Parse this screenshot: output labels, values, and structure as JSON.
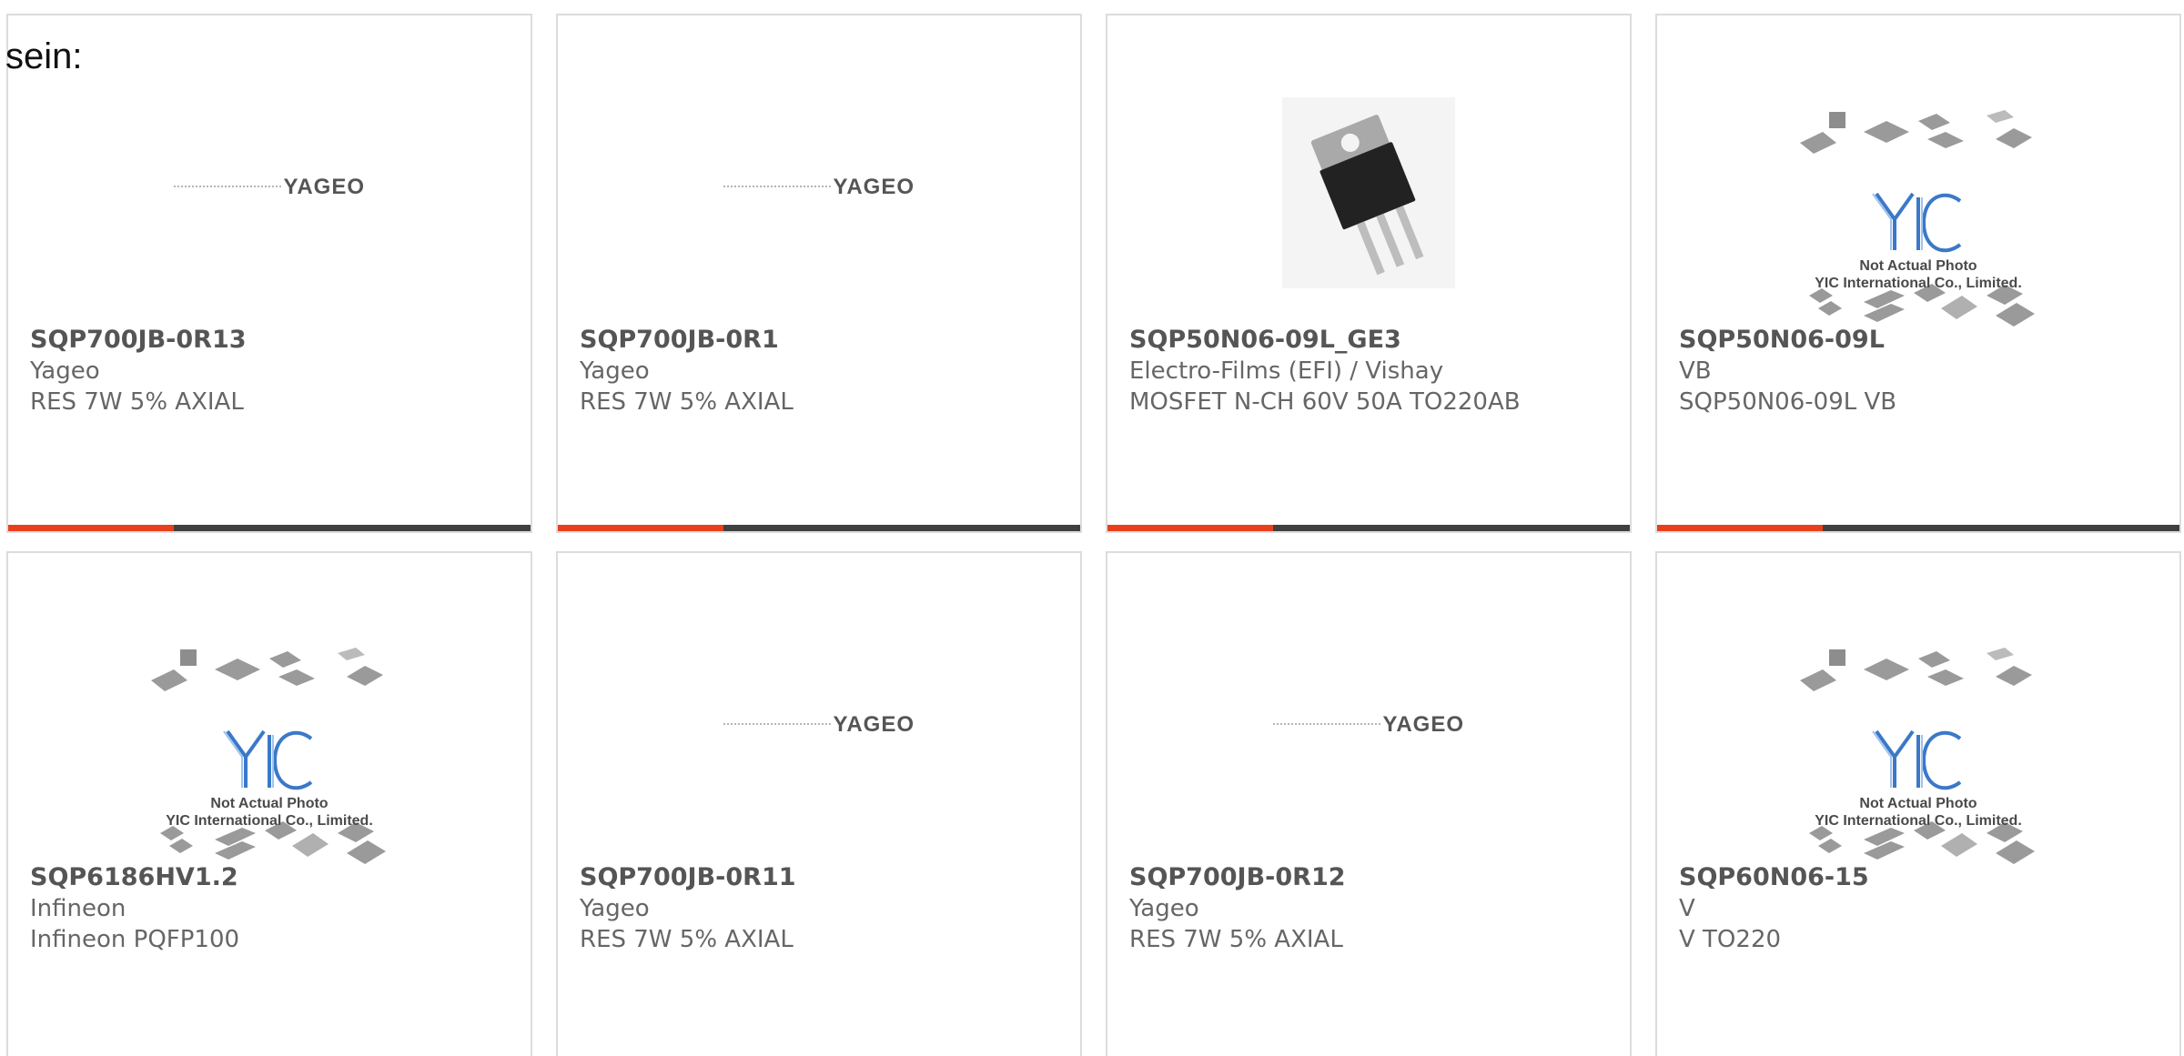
{
  "intro": "sein:",
  "cards": [
    {
      "part": "SQP700JB-0R13",
      "manufacturer": "Yageo",
      "description": "RES 7W 5% AXIAL",
      "image": "yageo-logo"
    },
    {
      "part": "SQP700JB-0R1",
      "manufacturer": "Yageo",
      "description": "RES 7W 5% AXIAL",
      "image": "yageo-logo"
    },
    {
      "part": "SQP50N06-09L_GE3",
      "manufacturer": "Electro-Films (EFI) / Vishay",
      "description": "MOSFET N-CH 60V 50A TO220AB",
      "image": "to220-transistor-photo"
    },
    {
      "part": "SQP50N06-09L",
      "manufacturer": "VB",
      "description": "SQP50N06-09L VB",
      "image": "yic-not-actual-photo"
    },
    {
      "part": "SQP6186HV1.2",
      "manufacturer": "Infineon",
      "description": "Infineon PQFP100",
      "image": "yic-not-actual-photo"
    },
    {
      "part": "SQP700JB-0R11",
      "manufacturer": "Yageo",
      "description": "RES 7W 5% AXIAL",
      "image": "yageo-logo"
    },
    {
      "part": "SQP700JB-0R12",
      "manufacturer": "Yageo",
      "description": "RES 7W 5% AXIAL",
      "image": "yageo-logo"
    },
    {
      "part": "SQP60N06-15",
      "manufacturer": "V",
      "description": "V TO220",
      "image": "yic-not-actual-photo"
    }
  ],
  "logos": {
    "yageo": "YAGEO",
    "yic_line1": "Not Actual Photo",
    "yic_line2": "YIC International Co., Limited."
  },
  "colors": {
    "accent": "#e8401c",
    "bar": "#404040",
    "text": "#555555"
  }
}
